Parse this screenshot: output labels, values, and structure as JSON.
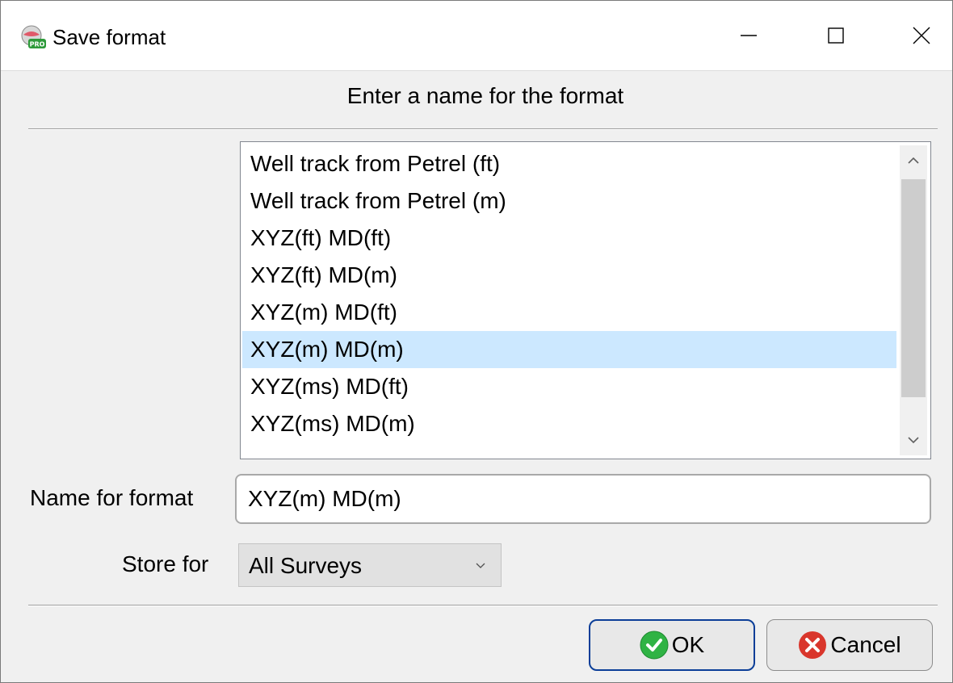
{
  "window": {
    "title": "Save format"
  },
  "heading": "Enter a name for the format",
  "list": {
    "items": [
      "Well track from Petrel (ft)",
      "Well track from Petrel (m)",
      "XYZ(ft) MD(ft)",
      "XYZ(ft) MD(m)",
      "XYZ(m) MD(ft)",
      "XYZ(m) MD(m)",
      "XYZ(ms) MD(ft)",
      "XYZ(ms) MD(m)"
    ],
    "selected": "XYZ(m) MD(m)"
  },
  "form": {
    "name_label": "Name for format",
    "name_value": "XYZ(m) MD(m)",
    "store_label": "Store for",
    "store_value": "All Surveys"
  },
  "buttons": {
    "ok_label": "OK",
    "cancel_label": "Cancel"
  },
  "colors": {
    "selection": "#cce8ff",
    "ok_border": "#0b3e98",
    "ok_icon": "#2fb344",
    "cancel_icon": "#d9362c"
  },
  "icons": {
    "app": "app-pro-icon",
    "minimize": "minimize-icon",
    "maximize": "maximize-icon",
    "close": "close-icon",
    "ok": "check-circle-icon",
    "cancel": "x-circle-icon"
  }
}
